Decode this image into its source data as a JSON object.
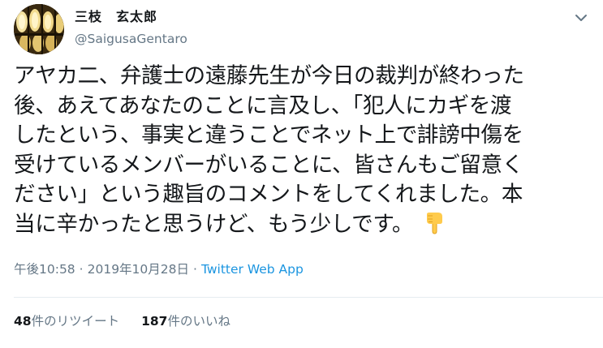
{
  "user": {
    "display_name": "三枝　玄太郎",
    "handle": "@SaigusaGentaro",
    "avatar_icon": "user-avatar-lanterns"
  },
  "menu": {
    "icon": "chevron-down-icon"
  },
  "tweet": {
    "lines": [
      "アヤカ二、弁護士の遠藤先生が今日の裁判が終わった",
      "後、あえてあなたのことに言及し、「犯人にカギを渡",
      "したという、事実と違うことでネット上で誹謗中傷を",
      "受けているメンバーがいることに、皆さんもご留意く",
      "ださい」という趣旨のコメントをしてくれました。本",
      "当に辛かったと思うけど、もう少しです。"
    ],
    "emoji": "backhand-index-pointing-down-emoji"
  },
  "meta": {
    "time": "午後10:58",
    "separator1": "·",
    "date": "2019年10月28日",
    "separator2": "·",
    "source": "Twitter Web App"
  },
  "stats": {
    "retweets_count": "48",
    "retweets_label": "件のリツイート",
    "likes_count": "187",
    "likes_label": "件のいいね"
  },
  "colors": {
    "text": "#14171a",
    "secondary": "#657786",
    "link": "#1b95e0",
    "divider": "#e6ecf0"
  }
}
